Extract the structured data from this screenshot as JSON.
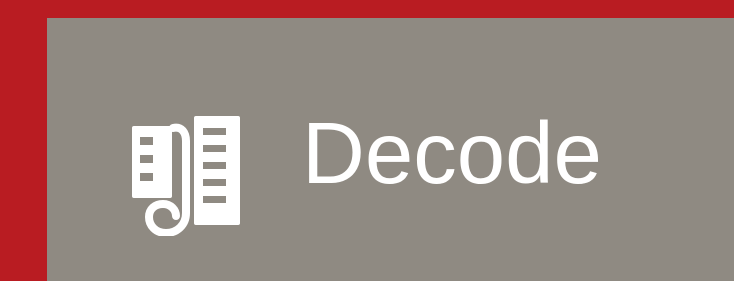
{
  "button": {
    "label": "Decode",
    "icon": "decode-scroll-icon",
    "background_color": "#8f8a82",
    "text_color": "#ffffff"
  },
  "frame": {
    "border_color": "#b91c22"
  }
}
